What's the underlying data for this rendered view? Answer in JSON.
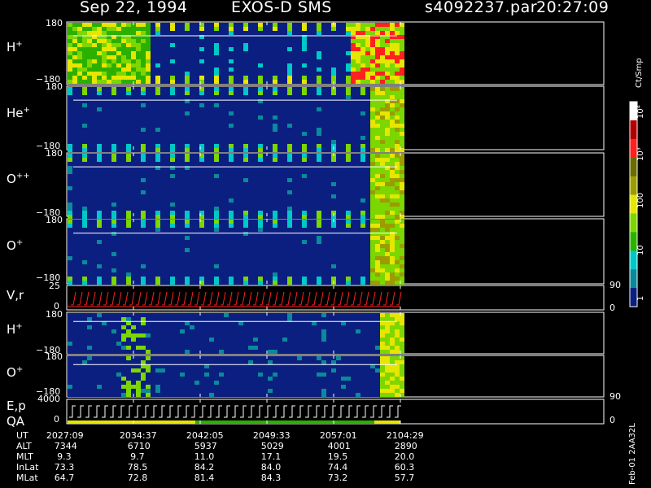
{
  "header": {
    "date": "Sep 22, 1994",
    "mission": "EXOS-D SMS",
    "file": "s4092237.par",
    "time": "20:27:09"
  },
  "panels": [
    {
      "id": "h",
      "label": "H",
      "sup": "+",
      "ytop": "180",
      "ybot": "−180"
    },
    {
      "id": "he",
      "label": "He",
      "sup": "+",
      "ytop": "180",
      "ybot": "−180"
    },
    {
      "id": "opp",
      "label": "O",
      "sup": "++",
      "ytop": "180",
      "ybot": "−180"
    },
    {
      "id": "op",
      "label": "O",
      "sup": "+",
      "ytop": "180",
      "ybot": "−180"
    },
    {
      "id": "vr",
      "label": "V,r",
      "sup": "",
      "ytop": "25",
      "ybot": "0",
      "rtop": "90",
      "rbot": "0"
    },
    {
      "id": "h2",
      "label": "H",
      "sup": "+",
      "ytop": "180",
      "ybot": "−180"
    },
    {
      "id": "o2",
      "label": "O",
      "sup": "+",
      "ytop": "180",
      "ybot": "−180"
    },
    {
      "id": "ep",
      "label": "E,p",
      "label2": "QA",
      "sup": "",
      "ytop": "4000",
      "ybot": "0",
      "rtop": "90",
      "rbot": "0"
    }
  ],
  "colorbar": {
    "unit": "Ct/Smp",
    "labels": [
      "10⁴",
      "10³",
      "100",
      "10",
      "1"
    ],
    "colors": [
      "#ffffff",
      "#b00000",
      "#ff2020",
      "#6b6b00",
      "#9c9c00",
      "#e6e600",
      "#7cd600",
      "#2cb000",
      "#00c8c8",
      "#0a8a9a",
      "#0b1f80"
    ]
  },
  "footer_note": "Feb-01 2AA32L",
  "table": {
    "row_labels": [
      "UT",
      "ALT",
      "MLT",
      "InLat",
      "MLat"
    ],
    "columns": [
      [
        "2027:09",
        "7344",
        "9.3",
        "73.3",
        "64.7"
      ],
      [
        "2034:37",
        "6710",
        "9.7",
        "78.5",
        "72.8"
      ],
      [
        "2042:05",
        "5937",
        "11.0",
        "84.2",
        "81.4"
      ],
      [
        "2049:33",
        "5029",
        "17.1",
        "84.0",
        "84.3"
      ],
      [
        "2057:01",
        "4001",
        "19.5",
        "74.4",
        "73.2"
      ],
      [
        "2104:29",
        "2890",
        "20.0",
        "60.3",
        "57.7"
      ]
    ]
  },
  "chart_data": {
    "type": "heatmap",
    "title": "Sep 22, 1994   EXOS-D SMS",
    "x_ticks": [
      "2027:09",
      "2034:37",
      "2042:05",
      "2049:33",
      "2057:01",
      "2104:29"
    ],
    "colorscale_unit": "Ct/Smp",
    "colorscale_range": [
      1,
      10000
    ],
    "panels": [
      "H+",
      "He+",
      "O++",
      "O+",
      "V,r",
      "H+",
      "O+",
      "E,p / QA"
    ],
    "pitch_angle_range": [
      -180,
      180
    ]
  }
}
